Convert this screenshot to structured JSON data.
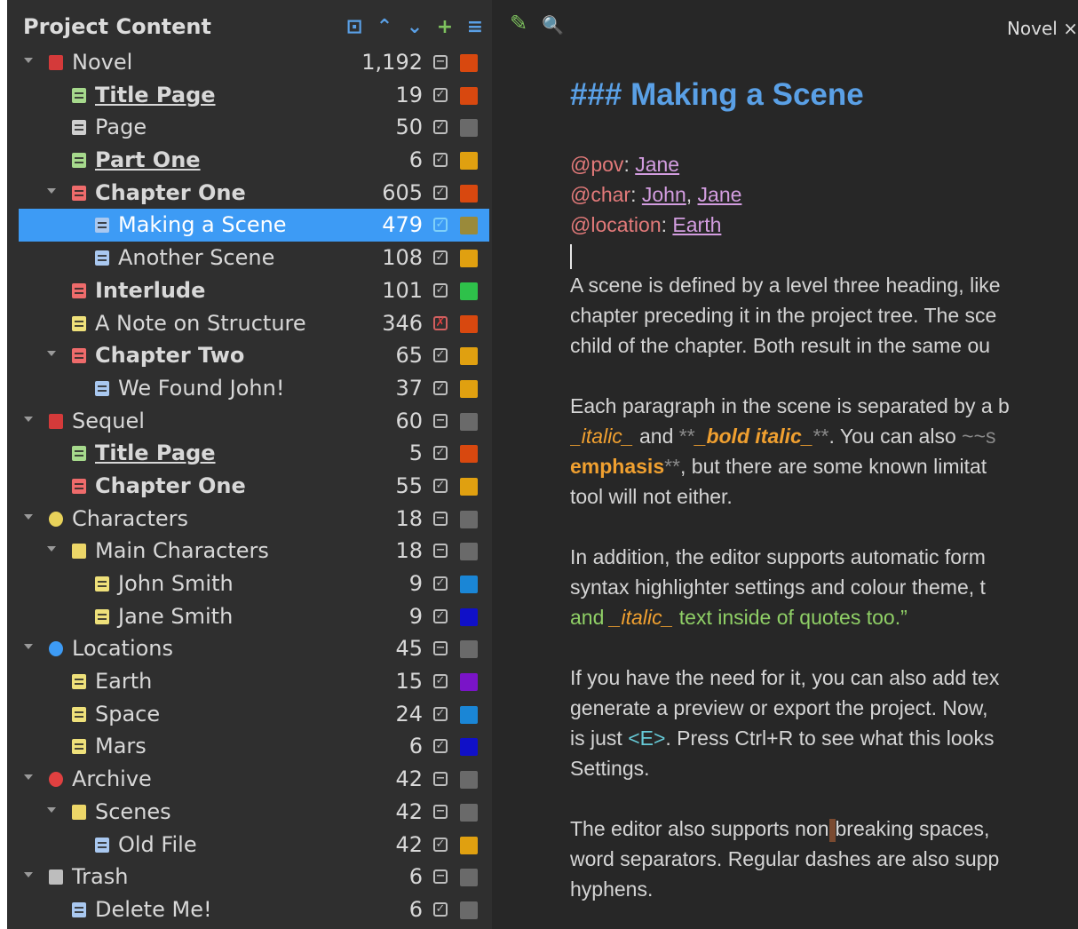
{
  "tree": {
    "title": "Project Content",
    "toolbar": [
      {
        "name": "bookmark-icon",
        "glyph": "⊡",
        "color": "#5aa0e6"
      },
      {
        "name": "chevron-up-icon",
        "glyph": "⌃",
        "color": "#5aa0e6"
      },
      {
        "name": "chevron-down-icon",
        "glyph": "⌄",
        "color": "#5aa0e6"
      },
      {
        "name": "add-icon",
        "glyph": "+",
        "color": "#7ec25e"
      },
      {
        "name": "menu-icon",
        "glyph": "≡",
        "color": "#5aa0e6"
      }
    ],
    "items": [
      {
        "label": "Novel",
        "depth": 0,
        "expand": true,
        "icon": "root-novel-icon",
        "iconColor": "#d43a3a",
        "count": "1,192",
        "status": "inactive",
        "color": "#d8480f"
      },
      {
        "label": "Title Page",
        "depth": 1,
        "expand": false,
        "icon": "document-icon",
        "iconColor": "#a6d98c",
        "bold": true,
        "underline": true,
        "count": "19",
        "status": "active",
        "color": "#d8480f"
      },
      {
        "label": "Page",
        "depth": 1,
        "expand": false,
        "icon": "document-icon",
        "iconColor": "#cfcfcf",
        "count": "50",
        "status": "active",
        "color": "#6a6a6a"
      },
      {
        "label": "Part One",
        "depth": 1,
        "expand": false,
        "icon": "document-icon",
        "iconColor": "#a6d98c",
        "bold": true,
        "underline": true,
        "count": "6",
        "status": "active",
        "color": "#e0a010"
      },
      {
        "label": "Chapter One",
        "depth": 1,
        "expand": true,
        "icon": "document-icon",
        "iconColor": "#ee6b6b",
        "bold": true,
        "count": "605",
        "status": "active",
        "color": "#d8480f"
      },
      {
        "label": "Making a Scene",
        "depth": 2,
        "expand": false,
        "icon": "document-icon",
        "iconColor": "#a9c8f0",
        "count": "479",
        "status": "active",
        "color": "#9a8a3a",
        "selected": true
      },
      {
        "label": "Another Scene",
        "depth": 2,
        "expand": false,
        "icon": "document-icon",
        "iconColor": "#a9c8f0",
        "count": "108",
        "status": "active",
        "color": "#e0a010"
      },
      {
        "label": "Interlude",
        "depth": 1,
        "expand": false,
        "icon": "document-icon",
        "iconColor": "#ee6b6b",
        "bold": true,
        "count": "101",
        "status": "active",
        "color": "#2ec14a"
      },
      {
        "label": "A Note on Structure",
        "depth": 1,
        "expand": false,
        "icon": "document-icon",
        "iconColor": "#eee07a",
        "count": "346",
        "status": "bad",
        "color": "#d8480f"
      },
      {
        "label": "Chapter Two",
        "depth": 1,
        "expand": true,
        "icon": "document-icon",
        "iconColor": "#ee6b6b",
        "bold": true,
        "count": "65",
        "status": "active",
        "color": "#e0a010"
      },
      {
        "label": "We Found John!",
        "depth": 2,
        "expand": false,
        "icon": "document-icon",
        "iconColor": "#a9c8f0",
        "count": "37",
        "status": "active",
        "color": "#e0a010"
      },
      {
        "label": "Sequel",
        "depth": 0,
        "expand": true,
        "icon": "root-novel-icon",
        "iconColor": "#d43a3a",
        "count": "60",
        "status": "inactive",
        "color": "#6a6a6a"
      },
      {
        "label": "Title Page",
        "depth": 1,
        "expand": false,
        "icon": "document-icon",
        "iconColor": "#a6d98c",
        "bold": true,
        "underline": true,
        "count": "5",
        "status": "active",
        "color": "#d8480f"
      },
      {
        "label": "Chapter One",
        "depth": 1,
        "expand": false,
        "icon": "document-icon",
        "iconColor": "#ee6b6b",
        "bold": true,
        "count": "55",
        "status": "active",
        "color": "#e0a010"
      },
      {
        "label": "Characters",
        "depth": 0,
        "expand": true,
        "icon": "person-icon",
        "iconColor": "#e8d25a",
        "count": "18",
        "status": "inactive",
        "color": "#6a6a6a"
      },
      {
        "label": "Main Characters",
        "depth": 1,
        "expand": true,
        "icon": "folder-icon",
        "iconColor": "#ecd668",
        "count": "18",
        "status": "inactive",
        "color": "#6a6a6a"
      },
      {
        "label": "John Smith",
        "depth": 2,
        "expand": false,
        "icon": "document-icon",
        "iconColor": "#eee07a",
        "count": "9",
        "status": "active",
        "color": "#1a86d6"
      },
      {
        "label": "Jane Smith",
        "depth": 2,
        "expand": false,
        "icon": "document-icon",
        "iconColor": "#eee07a",
        "count": "9",
        "status": "active",
        "color": "#1010c8"
      },
      {
        "label": "Locations",
        "depth": 0,
        "expand": true,
        "icon": "location-pin-icon",
        "iconColor": "#3d9bf5",
        "count": "45",
        "status": "inactive",
        "color": "#6a6a6a"
      },
      {
        "label": "Earth",
        "depth": 1,
        "expand": false,
        "icon": "document-icon",
        "iconColor": "#eee07a",
        "count": "15",
        "status": "active",
        "color": "#7a14c8"
      },
      {
        "label": "Space",
        "depth": 1,
        "expand": false,
        "icon": "document-icon",
        "iconColor": "#eee07a",
        "count": "24",
        "status": "active",
        "color": "#1a86d6"
      },
      {
        "label": "Mars",
        "depth": 1,
        "expand": false,
        "icon": "document-icon",
        "iconColor": "#eee07a",
        "count": "6",
        "status": "active",
        "color": "#1010c8"
      },
      {
        "label": "Archive",
        "depth": 0,
        "expand": true,
        "icon": "archive-icon",
        "iconColor": "#e04040",
        "count": "42",
        "status": "inactive",
        "color": "#6a6a6a"
      },
      {
        "label": "Scenes",
        "depth": 1,
        "expand": true,
        "icon": "folder-icon",
        "iconColor": "#ecd668",
        "count": "42",
        "status": "inactive",
        "color": "#6a6a6a"
      },
      {
        "label": "Old File",
        "depth": 2,
        "expand": false,
        "icon": "document-icon",
        "iconColor": "#a9c8f0",
        "count": "42",
        "status": "active",
        "color": "#e0a010"
      },
      {
        "label": "Trash",
        "depth": 0,
        "expand": true,
        "icon": "trash-icon",
        "iconColor": "#bdbdbd",
        "count": "6",
        "status": "inactive",
        "color": "#6a6a6a"
      },
      {
        "label": "Delete Me!",
        "depth": 1,
        "expand": false,
        "icon": "document-icon",
        "iconColor": "#a9c8f0",
        "count": "6",
        "status": "active",
        "color": "#6a6a6a"
      }
    ]
  },
  "editor": {
    "tools": [
      {
        "name": "edit-pencil-icon",
        "glyph": "✎"
      },
      {
        "name": "search-icon",
        "glyph": "🔍"
      }
    ],
    "doc_title": "Novel",
    "heading": "### Making a Scene",
    "meta": [
      {
        "key": "@pov",
        "values": [
          "Jane"
        ]
      },
      {
        "key": "@char",
        "values": [
          "John",
          "Jane"
        ]
      },
      {
        "key": "@location",
        "values": [
          "Earth"
        ]
      }
    ],
    "p1": [
      "A scene is defined by a level three heading, like",
      "chapter preceding it in the project tree. The sce",
      "child of the chapter. Both result in the same ou"
    ],
    "p2": {
      "l1": "Each paragraph in the scene is separated by a b",
      "l2_a": "_italic_",
      "l2_b": " and ",
      "l2_c": "**",
      "l2_d": "_bold italic_",
      "l2_e": "**",
      "l2_f": ". You can also ",
      "l2_g": "~~s",
      "l3_a": "emphasis",
      "l3_b": "**",
      "l3_c": ", but there are some known limitat",
      "l4": "tool will not either."
    },
    "p3": {
      "l1": "In addition, the editor supports automatic form",
      "l2": "syntax highlighter settings and colour theme, t",
      "l3_a": "and ",
      "l3_b": "_italic_",
      "l3_c": " text inside of quotes too.”"
    },
    "p4": {
      "l1": "If you have the need for it, you can also add tex",
      "l2": "generate a preview or export the project. Now,",
      "l3_a": "is just ",
      "l3_b": "<E>",
      "l3_c": ". Press Ctrl+R to see what this looks",
      "l4": "Settings."
    },
    "p5": {
      "l1_a": "The editor also supports non",
      "l1_b": "breaking spaces,",
      "l2": "word separators. Regular dashes are also supp",
      "l3": "hyphens."
    }
  }
}
